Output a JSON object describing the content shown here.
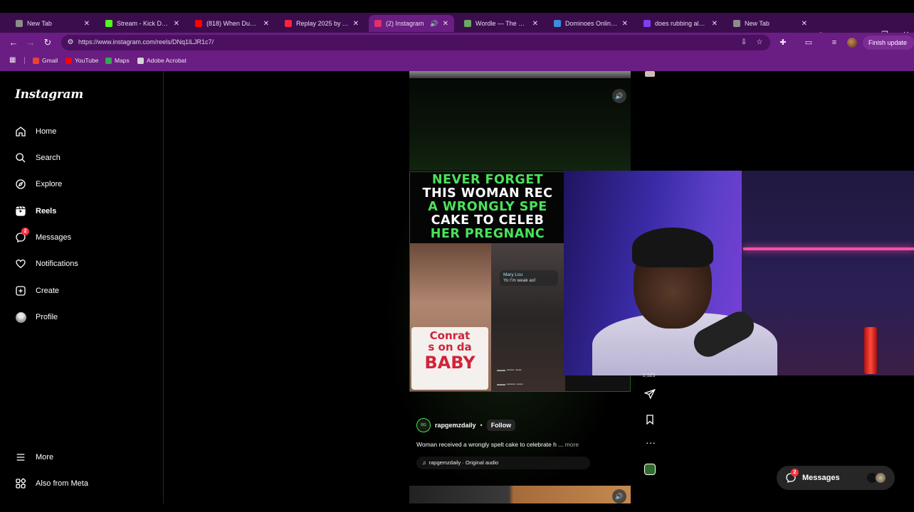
{
  "browser": {
    "tabs": [
      {
        "title": "New Tab",
        "fav": "#8c8c8c",
        "active": false,
        "audio": false
      },
      {
        "title": "Stream - Kick Dashbo",
        "fav": "#53fc18",
        "active": false,
        "audio": false
      },
      {
        "title": "(818) When Dumb Pe",
        "fav": "#ff0000",
        "active": false,
        "audio": false
      },
      {
        "title": "Replay 2025 by Apple",
        "fav": "#fa243c",
        "active": false,
        "audio": false
      },
      {
        "title": "(2) Instagram",
        "fav": "#e1306c",
        "active": true,
        "audio": true
      },
      {
        "title": "Wordle — The New Y",
        "fav": "#6aaa64",
        "active": false,
        "audio": false
      },
      {
        "title": "Dominoes Online - Pl",
        "fav": "#3c8dde",
        "active": false,
        "audio": false
      },
      {
        "title": "does rubbing alcohol",
        "fav": "#7e3ff2",
        "active": false,
        "audio": false
      },
      {
        "title": "New Tab",
        "fav": "#8c8c8c",
        "active": false,
        "audio": false
      }
    ],
    "url": "https://www.instagram.com/reels/DNq1lLJR1c7/",
    "finish_update": "Finish update",
    "bookmarks": [
      {
        "label": "Gmail",
        "color": "#ea4335"
      },
      {
        "label": "YouTube",
        "color": "#ff0000"
      },
      {
        "label": "Maps",
        "color": "#34a853"
      },
      {
        "label": "Adobe Acrobat",
        "color": "#d4d4d4"
      }
    ]
  },
  "instagram": {
    "logo": "Instagram",
    "nav": {
      "home": "Home",
      "search": "Search",
      "explore": "Explore",
      "reels": "Reels",
      "messages": "Messages",
      "messages_badge": "2",
      "notifications": "Notifications",
      "create": "Create",
      "profile": "Profile",
      "more": "More",
      "also_from_meta": "Also from Meta"
    },
    "reel": {
      "headline_lines": [
        "NEVER FORGET",
        "THIS WOMAN REC",
        "A WRONGLY SPE",
        "CAKE TO CELEB",
        "HER PREGNANC"
      ],
      "cake_text_top": "Conrat",
      "cake_text_mid": "s on da",
      "cake_text_big": "BABY",
      "chat_name": "Mary Lou",
      "chat_msg": "Yo I'm weak asf",
      "like_count": "2,329",
      "username": "rapgemzdaily",
      "dot": "•",
      "follow": "Follow",
      "caption": "Woman received a wrongly spelt cake to celebrate h ...",
      "more": "more",
      "audio": "rapgemzdaily · Original audio",
      "avatar_text": "RG"
    },
    "messages_pill": {
      "label": "Messages",
      "badge": "2"
    }
  }
}
